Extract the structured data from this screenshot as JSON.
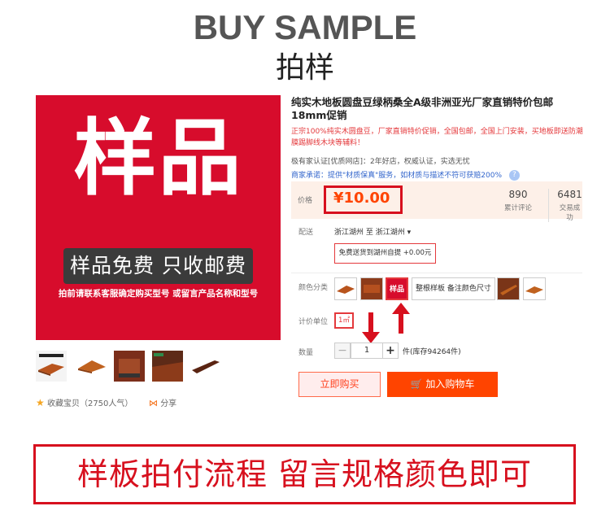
{
  "header": {
    "title_en": "BUY SAMPLE",
    "title_cn": "拍样"
  },
  "hero": {
    "big_text": "样品",
    "band_text": "样品免费 只收邮费",
    "note": "拍前请联系客服确定购买型号 或留言产品名称和型号",
    "bg_color": "#d70c2c"
  },
  "thumbs": [
    "wood-plank-thumb",
    "wood-profile-thumb",
    "sample-card-thumb",
    "wood-floor-room-thumb",
    "wood-board-thumb"
  ],
  "actions": {
    "favorite": "收藏宝贝（2750人气）",
    "share": "分享"
  },
  "product": {
    "title": "纯实木地板圆盘豆绿柄桑全A级非洲亚光厂家直销特价包邮18mm促销",
    "subtitle": "正宗100%纯实木圆盘豆，厂家直销特价促销，全国包邮，全国上门安装，买地板即送防潮膜踢脚线木块等辅料！",
    "badges": "极有家认证[优质网店]：2年好店，权威认证，实选无忧",
    "promise": "商家承诺：提供\"材质保真\"服务，如材质与描述不符可获赔200%"
  },
  "price": {
    "label": "价格",
    "value": "¥10.00",
    "reviews_num": "890",
    "reviews_label": "累计评论",
    "sales_num": "6481",
    "sales_label": "交易成功"
  },
  "shipping": {
    "label": "配送",
    "route": "浙江湖州 至  浙江湖州 ▾",
    "option": "免费送货到湖州自提 +0.00元"
  },
  "color": {
    "label": "颜色分类",
    "text_option": "整根样板 备注颜色尺寸",
    "selected_text": "样品"
  },
  "unit": {
    "label": "计价单位",
    "value": "1㎡"
  },
  "quantity": {
    "label": "数量",
    "minus": "−",
    "value": "1",
    "plus": "+",
    "stock": "件(库存94264件)"
  },
  "buttons": {
    "buy": "立即购买",
    "cart": "加入购物车"
  },
  "footer": {
    "text": "样板拍付流程 留言规格颜色即可"
  },
  "colors": {
    "accent": "#ff4400",
    "brand_red": "#d7101e"
  }
}
